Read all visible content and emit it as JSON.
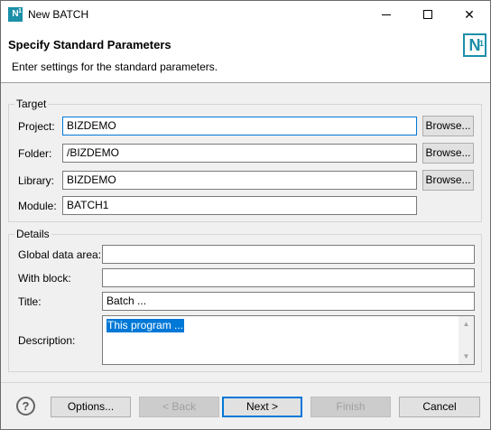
{
  "window": {
    "title": "New BATCH"
  },
  "header": {
    "title": "Specify Standard Parameters",
    "description": "Enter settings for the standard parameters."
  },
  "target": {
    "group_label": "Target",
    "project_label": "Project:",
    "project_value": "BIZDEMO",
    "folder_label": "Folder:",
    "folder_value": "/BIZDEMO",
    "library_label": "Library:",
    "library_value": "BIZDEMO",
    "module_label": "Module:",
    "module_value": "BATCH1",
    "browse_label": "Browse..."
  },
  "details": {
    "group_label": "Details",
    "gda_label": "Global data area:",
    "gda_value": "",
    "with_block_label": "With block:",
    "with_block_value": "",
    "title_label": "Title:",
    "title_value": "Batch ...",
    "description_label": "Description:",
    "description_value": "This program ..."
  },
  "buttons": {
    "options": "Options...",
    "back": "< Back",
    "next": "Next >",
    "finish": "Finish",
    "cancel": "Cancel"
  }
}
